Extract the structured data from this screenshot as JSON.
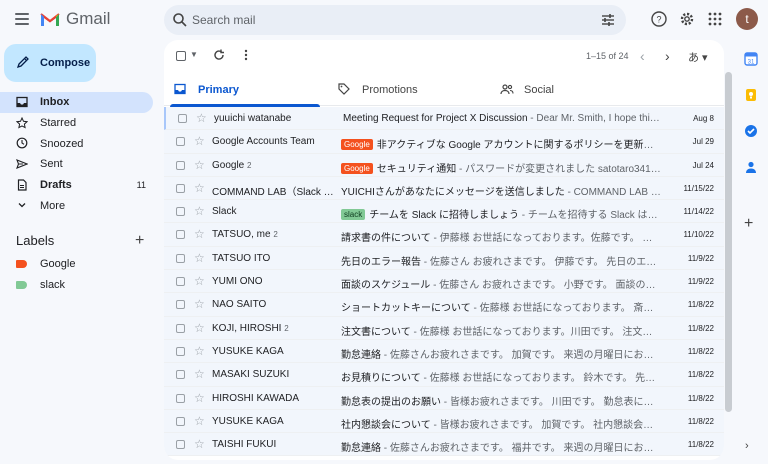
{
  "app": {
    "name": "Gmail",
    "avatar_letter": "t"
  },
  "search": {
    "placeholder": "Search mail"
  },
  "compose": {
    "label": "Compose"
  },
  "nav": [
    {
      "label": "Inbox",
      "icon": "inbox-icon",
      "active": true,
      "count": ""
    },
    {
      "label": "Starred",
      "icon": "star-icon",
      "count": ""
    },
    {
      "label": "Snoozed",
      "icon": "clock-icon",
      "count": ""
    },
    {
      "label": "Sent",
      "icon": "send-icon",
      "count": ""
    },
    {
      "label": "Drafts",
      "icon": "draft-icon",
      "bold": true,
      "count": "11"
    },
    {
      "label": "More",
      "icon": "chevron-down-icon",
      "count": ""
    }
  ],
  "labels": {
    "title": "Labels",
    "items": [
      {
        "name": "Google",
        "color": "#f4511e"
      },
      {
        "name": "slack",
        "color": "#81c995"
      }
    ]
  },
  "toolbar": {
    "range": "1–15 of 24",
    "lang": "あ"
  },
  "tabs": [
    {
      "label": "Primary",
      "icon": "inbox-icon",
      "active": true
    },
    {
      "label": "Promotions",
      "icon": "tag-icon"
    },
    {
      "label": "Social",
      "icon": "people-icon"
    }
  ],
  "emails": [
    {
      "sender": "yuuichi watanabe",
      "count": "",
      "badge": "",
      "badge_color": "",
      "subject": "Meeting Request for Project X Discussion",
      "snippet": " - Dear Mr. Smith, I hope this em…",
      "date": "Aug 8",
      "selected": true
    },
    {
      "sender": "Google Accounts Team",
      "count": "",
      "badge": "Google",
      "badge_color": "#f4511e",
      "subject": "非アクティブな Google アカウントに関するポリシーを更新します",
      "snippet": " - …",
      "date": "Jul 29"
    },
    {
      "sender": "Google",
      "count": "2",
      "badge": "Google",
      "badge_color": "#f4511e",
      "subject": "セキュリティ通知",
      "snippet": " - パスワードが変更されました satotaro341@g…",
      "date": "Jul 24"
    },
    {
      "sender": "COMMAND LAB（Slack …",
      "count": "",
      "badge": "",
      "badge_color": "",
      "subject": "YUICHIさんがあなたにメッセージを送信しました",
      "snippet": " - COMMAND LAB で起…",
      "date": "11/15/22"
    },
    {
      "sender": "Slack",
      "count": "",
      "badge": "slack",
      "badge_color": "#81c995",
      "subject": "チームを Slack に招待しましょう",
      "snippet": " - チームを招待する Slack はチー…",
      "date": "11/14/22"
    },
    {
      "sender": "TATSUO, me",
      "count": "2",
      "badge": "",
      "badge_color": "",
      "subject": "請求書の件について",
      "snippet": " - 伊藤様 お世話になっております。佐藤です。 請求書…",
      "date": "11/10/22"
    },
    {
      "sender": "TATSUO ITO",
      "count": "",
      "badge": "",
      "badge_color": "",
      "subject": "先日のエラー報告",
      "snippet": " - 佐藤さん お疲れさまです。 伊藤です。 先日のエラー…",
      "date": "11/9/22"
    },
    {
      "sender": "YUMI ONO",
      "count": "",
      "badge": "",
      "badge_color": "",
      "subject": "面談のスケジュール",
      "snippet": " - 佐藤さん お疲れさまです。 小野です。 面談のスケジ…",
      "date": "11/9/22"
    },
    {
      "sender": "NAO SAITO",
      "count": "",
      "badge": "",
      "badge_color": "",
      "subject": "ショートカットキーについて",
      "snippet": " - 佐藤様 お世話になっております。 斎藤です…",
      "date": "11/8/22"
    },
    {
      "sender": "KOJI, HIROSHI",
      "count": "2",
      "badge": "",
      "badge_color": "",
      "subject": "注文書について",
      "snippet": " - 佐藤様 お世話になっております。川田です。 注文書につ…",
      "date": "11/8/22"
    },
    {
      "sender": "YUSUKE KAGA",
      "count": "",
      "badge": "",
      "badge_color": "",
      "subject": "勤怠連絡",
      "snippet": " - 佐藤さんお疲れさまです。 加賀です。 来週の月曜日にお休みを…",
      "date": "11/8/22"
    },
    {
      "sender": "MASAKI SUZUKI",
      "count": "",
      "badge": "",
      "badge_color": "",
      "subject": "お見積りについて",
      "snippet": " - 佐藤様 お世話になっております。 鈴木です。 先日のス…",
      "date": "11/8/22"
    },
    {
      "sender": "HIROSHI KAWADA",
      "count": "",
      "badge": "",
      "badge_color": "",
      "subject": "勤怠表の提出のお願い",
      "snippet": " - 皆様お疲れさまです。 川田です。 勤怠表に提出に…",
      "date": "11/8/22"
    },
    {
      "sender": "YUSUKE KAGA",
      "count": "",
      "badge": "",
      "badge_color": "",
      "subject": "社内懇談会について",
      "snippet": " - 皆様お疲れさまです。 加賀です。 社内懇談会が来週…",
      "date": "11/8/22"
    },
    {
      "sender": "TAISHI FUKUI",
      "count": "",
      "badge": "",
      "badge_color": "",
      "subject": "勤怠連絡",
      "snippet": " - 佐藤さんお疲れさまです。 福井です。 来週の月曜日にお休みを…",
      "date": "11/8/22"
    }
  ]
}
